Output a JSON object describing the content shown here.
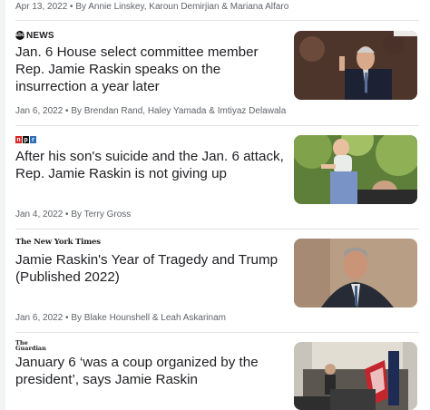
{
  "articles": [
    {
      "meta": "Apr 13, 2022 • By Annie Linskey, Karoun Demirjian & Mariana Alfaro"
    },
    {
      "source": "NEWS",
      "source_mark": "abc",
      "title": "Jan. 6 House select committee member Rep. Jamie Raskin speaks on the insurrection a year later",
      "meta": "Jan 6, 2022 • By Brendan Rand, Haley Yamada & Imtiyaz Delawala"
    },
    {
      "source_letters": [
        "n",
        "p",
        "r"
      ],
      "title": "After his son's suicide and the Jan. 6 attack, Rep. Jamie Raskin is not giving up",
      "meta": "Jan 4, 2022 • By Terry Gross"
    },
    {
      "source": "The New York Times",
      "title": "Jamie Raskin's Year of Tragedy and Trump (Published 2022)",
      "meta": "Jan 6, 2022 • By Blake Hounshell & Leah Askarinam"
    },
    {
      "source_line1": "The",
      "source_line2": "Guardian",
      "title": "January 6 ‘was a coup organized by the president’, says Jamie Raskin"
    }
  ],
  "colors": {
    "npr_red": "#d62021",
    "npr_black": "#111111",
    "npr_blue": "#2f6fb3"
  }
}
